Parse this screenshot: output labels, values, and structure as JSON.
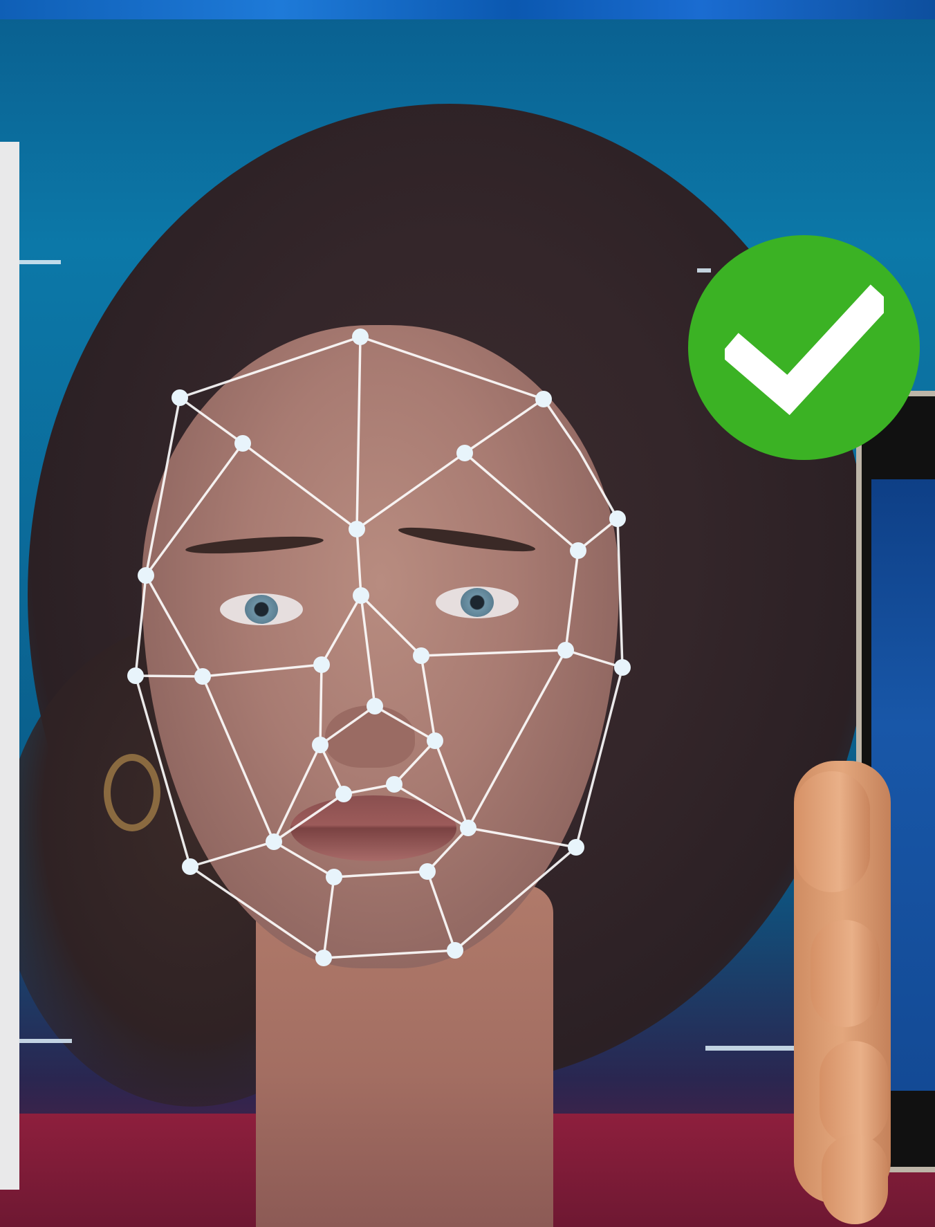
{
  "image": {
    "subject": "face-recognition-scan",
    "colors": {
      "background": "#0b6a99",
      "mesh": "#ffffff",
      "check_badge": "#3bb224",
      "shirt": "#8e1f3d"
    }
  },
  "phone_screen": {
    "top_text": "",
    "bottom_text": ""
  },
  "icons": [
    "check-icon"
  ]
}
